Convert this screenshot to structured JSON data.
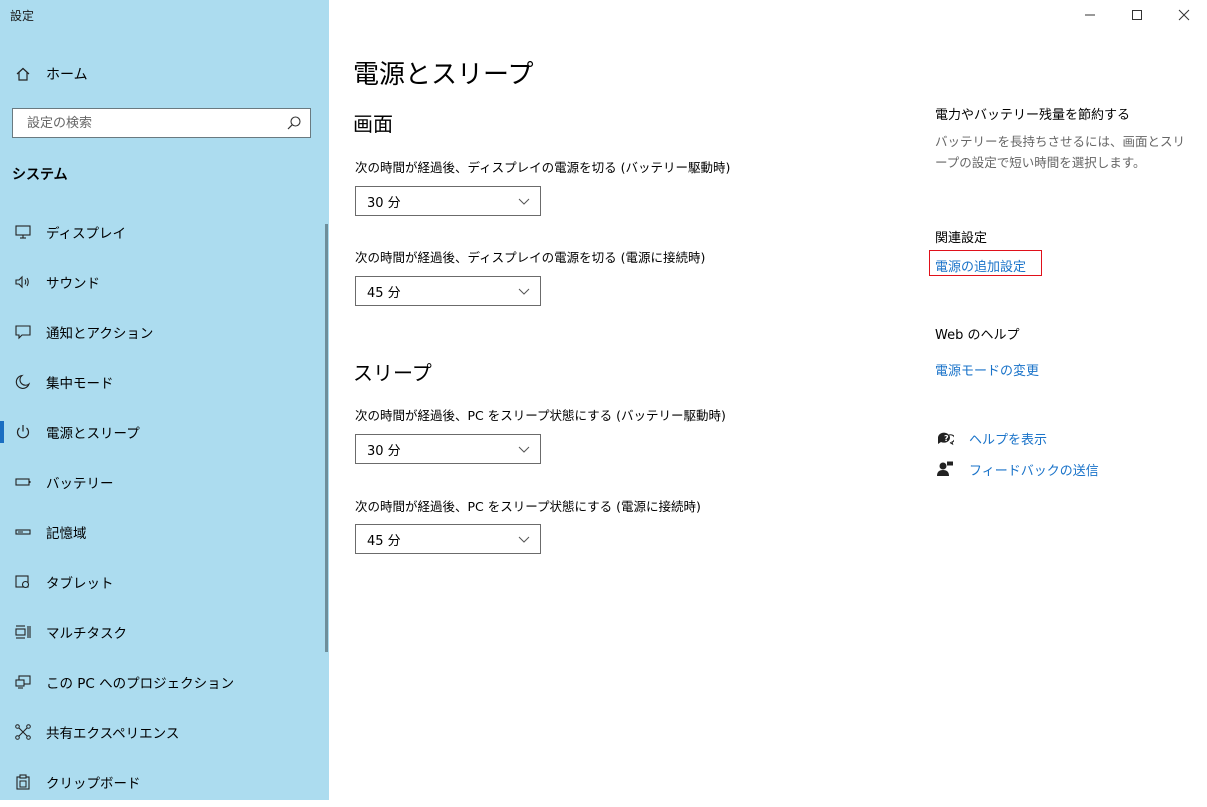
{
  "window": {
    "title": "設定",
    "controls": {
      "minimize": "minimize-icon",
      "maximize": "maximize-icon",
      "close": "close-icon"
    }
  },
  "sidebar": {
    "home_label": "ホーム",
    "search_placeholder": "設定の検索",
    "section_title": "システム",
    "items": [
      {
        "label": "ディスプレイ",
        "icon": "display-icon"
      },
      {
        "label": "サウンド",
        "icon": "speaker-icon"
      },
      {
        "label": "通知とアクション",
        "icon": "notification-icon"
      },
      {
        "label": "集中モード",
        "icon": "moon-icon"
      },
      {
        "label": "電源とスリープ",
        "icon": "power-icon",
        "active": true
      },
      {
        "label": "バッテリー",
        "icon": "battery-icon"
      },
      {
        "label": "記憶域",
        "icon": "storage-icon"
      },
      {
        "label": "タブレット",
        "icon": "tablet-icon"
      },
      {
        "label": "マルチタスク",
        "icon": "multitask-icon"
      },
      {
        "label": "この PC へのプロジェクション",
        "icon": "projection-icon"
      },
      {
        "label": "共有エクスペリエンス",
        "icon": "shared-experience-icon"
      },
      {
        "label": "クリップボード",
        "icon": "clipboard-icon"
      }
    ]
  },
  "main": {
    "title": "電源とスリープ",
    "screen": {
      "heading": "画面",
      "battery_label": "次の時間が経過後、ディスプレイの電源を切る (バッテリー駆動時)",
      "battery_value": "30 分",
      "plugged_label": "次の時間が経過後、ディスプレイの電源を切る (電源に接続時)",
      "plugged_value": "45 分"
    },
    "sleep": {
      "heading": "スリープ",
      "battery_label": "次の時間が経過後、PC をスリープ状態にする (バッテリー駆動時)",
      "battery_value": "30 分",
      "plugged_label": "次の時間が経過後、PC をスリープ状態にする (電源に接続時)",
      "plugged_value": "45 分"
    }
  },
  "right": {
    "save_title": "電力やバッテリー残量を節約する",
    "save_desc": "バッテリーを長持ちさせるには、画面とスリープの設定で短い時間を選択します。",
    "related_title": "関連設定",
    "related_link": "電源の追加設定",
    "web_help_title": "Web のヘルプ",
    "web_help_link": "電源モードの変更",
    "get_help": "ヘルプを表示",
    "feedback": "フィードバックの送信"
  },
  "colors": {
    "sidebar_bg": "#acdcef",
    "accent": "#1a73c9",
    "highlight_border": "#e0101a"
  }
}
